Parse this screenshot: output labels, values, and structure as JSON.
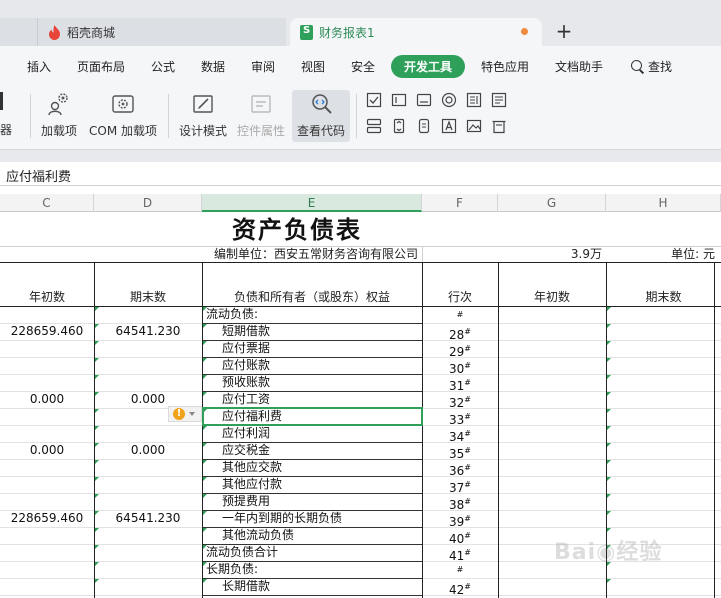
{
  "tabs": [
    {
      "label": "稻壳商城"
    },
    {
      "label": "财务报表1"
    }
  ],
  "menu": {
    "items": [
      "插入",
      "页面布局",
      "公式",
      "数据",
      "审阅",
      "视图",
      "安全",
      "开发工具",
      "特色应用",
      "文档助手"
    ],
    "active": "开发工具",
    "search_label": "查找"
  },
  "ribbon": {
    "edge_label": "器",
    "buttons": [
      {
        "label": "加载项"
      },
      {
        "label": "COM 加载项"
      },
      {
        "label": "设计模式"
      },
      {
        "label": "控件属性"
      },
      {
        "label": "查看代码"
      }
    ]
  },
  "formula_bar": {
    "value": "应付福利费"
  },
  "columns": [
    "C",
    "D",
    "E",
    "F",
    "G",
    "H"
  ],
  "sheet": {
    "title": "资产负债表",
    "org_line": "编制单位：西安五常财务咨询有限公司",
    "amount_note": "3.9万",
    "unit_note": "单位: 元",
    "headers": {
      "c": "年初数",
      "d": "期末数",
      "e": "负债和所有者（或股东）权益",
      "f": "行次",
      "g": "年初数",
      "h": "期末数"
    },
    "rows": [
      {
        "c": "",
        "d": "",
        "e": "流动负债:",
        "f": "#"
      },
      {
        "c": "228659.460",
        "d": "64541.230",
        "e": "短期借款",
        "f": "28"
      },
      {
        "c": "",
        "d": "",
        "e": "应付票据",
        "f": "29"
      },
      {
        "c": "",
        "d": "",
        "e": "应付账款",
        "f": "30"
      },
      {
        "c": "",
        "d": "",
        "e": "预收账款",
        "f": "31"
      },
      {
        "c": "0.000",
        "d": "0.000",
        "e": "应付工资",
        "f": "32"
      },
      {
        "c": "",
        "d": "",
        "e": "应付福利费",
        "f": "33"
      },
      {
        "c": "",
        "d": "",
        "e": "应付利润",
        "f": "34"
      },
      {
        "c": "0.000",
        "d": "0.000",
        "e": "应交税金",
        "f": "35"
      },
      {
        "c": "",
        "d": "",
        "e": "其他应交款",
        "f": "36"
      },
      {
        "c": "",
        "d": "",
        "e": "其他应付款",
        "f": "37"
      },
      {
        "c": "",
        "d": "",
        "e": "预提费用",
        "f": "38"
      },
      {
        "c": "228659.460",
        "d": "64541.230",
        "e": "一年内到期的长期负债",
        "f": "39"
      },
      {
        "c": "",
        "d": "",
        "e": "其他流动负债",
        "f": "40"
      },
      {
        "c": "",
        "d": "",
        "e": "流动负债合计",
        "f": "41"
      },
      {
        "c": "",
        "d": "",
        "e": "长期负债:",
        "f": "#"
      },
      {
        "c": "",
        "d": "",
        "e": "长期借款",
        "f": "42"
      }
    ],
    "hash_mark": "#",
    "selected_row_index": 6
  },
  "colors": {
    "accent": "#2ea05a",
    "warning": "#f0a21a",
    "unsaved": "#f08a3e"
  }
}
